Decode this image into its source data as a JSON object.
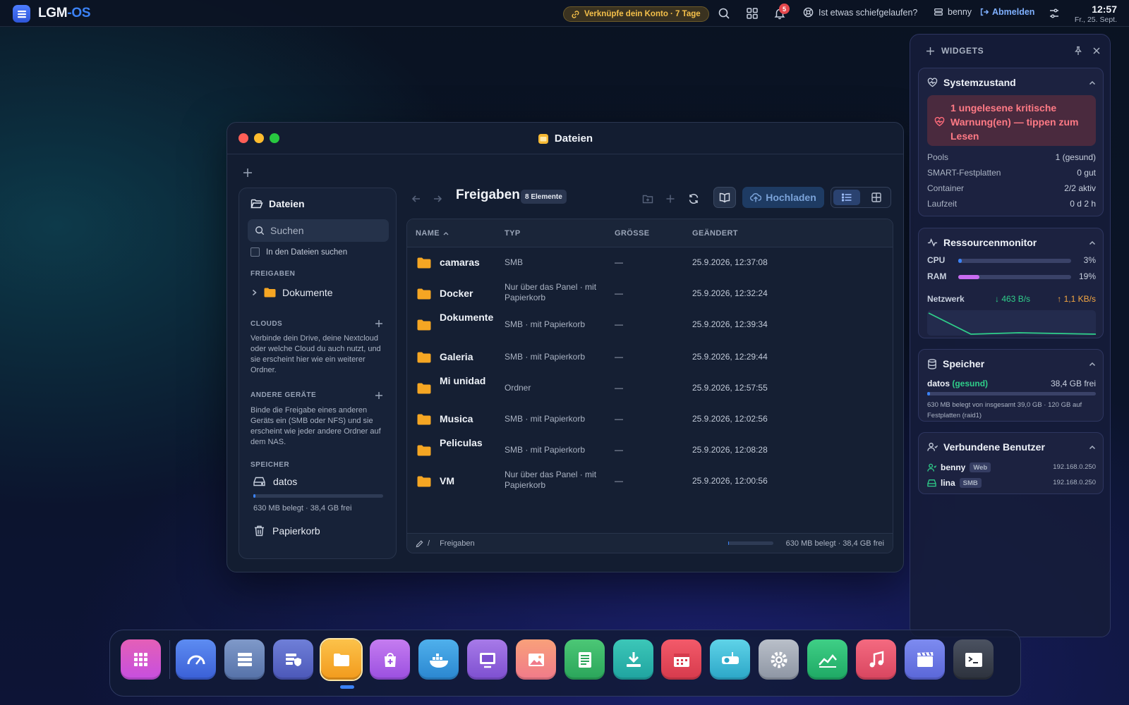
{
  "topbar": {
    "brand_main": "LGM",
    "brand_accent": "-OS",
    "link_account": "Verknüpfe dein Konto · 7 Tage",
    "notification_count": "5",
    "help": "Ist etwas schiefgelaufen?",
    "user": "benny",
    "logout": "Abmelden",
    "time": "12:57",
    "date": "Fr., 25. Sept.",
    "icons": [
      "menu-icon",
      "link-icon",
      "search-icon",
      "apps-grid-icon",
      "bell-icon",
      "help-icon",
      "user-icon",
      "logout-icon",
      "sliders-icon"
    ]
  },
  "window": {
    "title": "Dateien",
    "sidebar": {
      "title": "Dateien",
      "search_placeholder": "Suchen",
      "search_in_files": "In den Dateien suchen",
      "section_shares": "FREIGABEN",
      "tree_item": "Dokumente",
      "section_clouds": "CLOUDS",
      "clouds_desc": "Verbinde dein Drive, deine Nextcloud oder welche Cloud du auch nutzt, und sie erscheint hier wie ein weiterer Ordner.",
      "section_devices": "ANDERE GERÄTE",
      "devices_desc": "Binde die Freigabe eines anderen Geräts ein (SMB oder NFS) und sie erscheint wie jeder andere Ordner auf dem NAS.",
      "section_storage": "SPEICHER",
      "storage_name": "datos",
      "storage_usage_fraction": 0.016,
      "storage_usage": "630 MB belegt · 38,4 GB frei",
      "trash": "Papierkorb"
    },
    "main": {
      "title": "Freigaben",
      "count_badge": "8 Elemente",
      "upload": "Hochladen",
      "columns": {
        "name": "NAME",
        "type": "TYP",
        "size": "GRÖSSE",
        "modified": "GEÄNDERT"
      },
      "rows": [
        {
          "name": "camaras",
          "type": "SMB",
          "size": "—",
          "modified": "25.9.2026, 12:37:08"
        },
        {
          "name": "Docker",
          "type": "Nur über das Panel · mit Papierkorb",
          "size": "—",
          "modified": "25.9.2026, 12:32:24"
        },
        {
          "name": "Dokumente",
          "type": "SMB · mit Papierkorb",
          "size": "—",
          "modified": "25.9.2026, 12:39:34"
        },
        {
          "name": "Galeria",
          "type": "SMB · mit Papierkorb",
          "size": "—",
          "modified": "25.9.2026, 12:29:44"
        },
        {
          "name": "Mi unidad",
          "type": "Ordner",
          "size": "—",
          "modified": "25.9.2026, 12:57:55"
        },
        {
          "name": "Musica",
          "type": "SMB · mit Papierkorb",
          "size": "—",
          "modified": "25.9.2026, 12:02:56"
        },
        {
          "name": "Peliculas",
          "type": "SMB · mit Papierkorb",
          "size": "—",
          "modified": "25.9.2026, 12:08:28"
        },
        {
          "name": "VM",
          "type": "Nur über das Panel · mit Papierkorb",
          "size": "—",
          "modified": "25.9.2026, 12:00:56"
        }
      ],
      "footer_slash": "/",
      "footer_path": "Freigaben",
      "footer_usage": "630 MB belegt · 38,4 GB frei"
    }
  },
  "widgets": {
    "title": "WIDGETS",
    "system": {
      "title": "Systemzustand",
      "alert": "1 ungelesene kritische Warnung(en) — tippen zum Lesen",
      "rows": [
        {
          "k": "Pools",
          "v": "1 (gesund)"
        },
        {
          "k": "SMART-Festplatten",
          "v": "0 gut"
        },
        {
          "k": "Container",
          "v": "2/2 aktiv"
        },
        {
          "k": "Laufzeit",
          "v": "0 d 2 h"
        }
      ]
    },
    "resources": {
      "title": "Ressourcenmonitor",
      "cpu_label": "CPU",
      "cpu_value": "3%",
      "cpu_fraction": 0.03,
      "ram_label": "RAM",
      "ram_value": "19%",
      "ram_fraction": 0.19,
      "net_label": "Netzwerk",
      "net_down": "↓ 463 B/s",
      "net_up": "↑ 1,1 KB/s",
      "cpu_color": "#3b82f6",
      "ram_color": "#c86bf0"
    },
    "storage": {
      "title": "Speicher",
      "pool": "datos",
      "pool_status": "(gesund)",
      "free": "38,4 GB frei",
      "usage_fraction": 0.016,
      "note": "630 MB belegt von insgesamt 39,0 GB · 120 GB auf Festplatten (raid1)"
    },
    "users": {
      "title": "Verbundene Benutzer",
      "list": [
        {
          "name": "benny",
          "tag": "Web",
          "ip": "192.168.0.250"
        },
        {
          "name": "lina",
          "tag": "SMB",
          "ip": "192.168.0.250"
        }
      ]
    }
  },
  "dock": {
    "apps": [
      "launcher-icon",
      "dashboard-icon",
      "storage-icon",
      "security-icon",
      "files-icon",
      "app-store-icon",
      "docker-icon",
      "virtual-machine-icon",
      "photos-icon",
      "notes-icon",
      "downloads-icon",
      "calendar-icon",
      "projector-icon",
      "settings-icon",
      "monitor-icon",
      "music-icon",
      "video-icon",
      "terminal-icon"
    ]
  }
}
